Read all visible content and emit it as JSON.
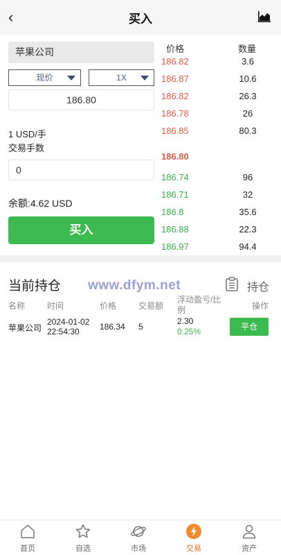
{
  "header": {
    "title": "买入"
  },
  "form": {
    "stock_name": "苹果公司",
    "order_type": "现价",
    "leverage": "1X",
    "price": "186.80",
    "unit": "1 USD/手",
    "lots_label": "交易手数",
    "lots_value": "0",
    "balance": "余额:4.62 USD",
    "buy_label": "买入"
  },
  "orderbook": {
    "price_header": "价格",
    "qty_header": "数量",
    "asks": [
      {
        "price": "186.82",
        "qty": "3.6"
      },
      {
        "price": "186.87",
        "qty": "10.6"
      },
      {
        "price": "186.82",
        "qty": "26.3"
      },
      {
        "price": "186.78",
        "qty": "26"
      },
      {
        "price": "186.85",
        "qty": "80.3"
      }
    ],
    "last_price": "186.80",
    "bids": [
      {
        "price": "186.74",
        "qty": "96"
      },
      {
        "price": "186.71",
        "qty": "32"
      },
      {
        "price": "186.8",
        "qty": "35.6"
      },
      {
        "price": "186.88",
        "qty": "22.3"
      },
      {
        "price": "186.97",
        "qty": "94.4"
      }
    ]
  },
  "positions": {
    "title": "当前持仓",
    "watermark": "www.dfym.net",
    "hold_link": "持仓",
    "columns": [
      "名称",
      "时间",
      "价格",
      "交易额",
      "浮动盈亏/比例",
      "操作"
    ],
    "rows": [
      {
        "name": "苹果公司",
        "date": "2024-01-02",
        "time": "22:54:30",
        "price": "186.34",
        "amount": "5",
        "pnl": "2.30",
        "pnl_pct": "0.25%",
        "action": "平仓"
      }
    ]
  },
  "nav": {
    "items": [
      {
        "label": "首页",
        "icon": "home-icon"
      },
      {
        "label": "自选",
        "icon": "star-icon"
      },
      {
        "label": "市场",
        "icon": "planet-icon"
      },
      {
        "label": "交易",
        "icon": "trade-icon"
      },
      {
        "label": "资产",
        "icon": "user-icon"
      }
    ],
    "active_index": 3
  },
  "colors": {
    "accent_green": "#3cba4f",
    "ask_red": "#e05b48",
    "bid_green": "#3cb04a",
    "nav_active": "#ee6e2a"
  }
}
